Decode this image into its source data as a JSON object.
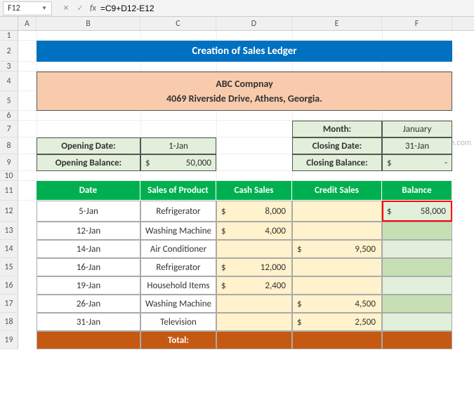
{
  "namebox": "F12",
  "formula": "=C9+D12-E12",
  "cols": {
    "A": 26,
    "B": 148,
    "C": 108,
    "D": 108,
    "E": 128,
    "F": 100
  },
  "title": "Creation of Sales Ledger",
  "company": {
    "name": "ABC Compnay",
    "address": "4069 Riverside Drive, Athens, Georgia."
  },
  "opening": {
    "date_label": "Opening Date:",
    "date": "1-Jan",
    "bal_label": "Opening Balance:",
    "curr": "$",
    "bal": "50,000"
  },
  "closing": {
    "month_label": "Month:",
    "month": "January",
    "date_label": "Closing Date:",
    "date": "31-Jan",
    "bal_label": "Closing Balance:",
    "curr": "$",
    "bal": "-"
  },
  "headers": {
    "date": "Date",
    "product": "Sales of Product",
    "cash": "Cash Sales",
    "credit": "Credit Sales",
    "balance": "Balance"
  },
  "rows": [
    {
      "date": "5-Jan",
      "product": "Refrigerator",
      "cash": "8,000",
      "credit": "",
      "balance": "58,000"
    },
    {
      "date": "12-Jan",
      "product": "Washing Machine",
      "cash": "4,000",
      "credit": "",
      "balance": ""
    },
    {
      "date": "14-Jan",
      "product": "Air Conditioner",
      "cash": "",
      "credit": "9,500",
      "balance": ""
    },
    {
      "date": "16-Jan",
      "product": "Refrigerator",
      "cash": "12,000",
      "credit": "",
      "balance": ""
    },
    {
      "date": "19-Jan",
      "product": "Household Items",
      "cash": "2,400",
      "credit": "",
      "balance": ""
    },
    {
      "date": "26-Jan",
      "product": "Washing Machine",
      "cash": "",
      "credit": "4,500",
      "balance": ""
    },
    {
      "date": "31-Jan",
      "product": "Television",
      "cash": "",
      "credit": "2,500",
      "balance": ""
    }
  ],
  "total_label": "Total:",
  "curr": "$",
  "watermark": "wsxdn.com"
}
